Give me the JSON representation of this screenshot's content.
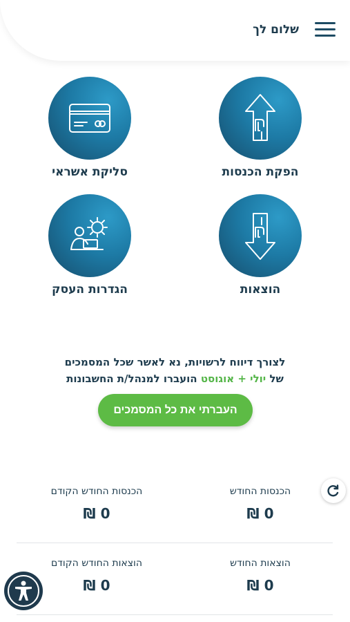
{
  "header": {
    "greeting": "שלום לך",
    "menu_icon": "hamburger-menu-icon"
  },
  "tiles": [
    {
      "label": "הפקת הכנסות",
      "icon": "income-arrow-up-shekel-icon"
    },
    {
      "label": "סליקת אשראי",
      "icon": "credit-card-icon"
    },
    {
      "label": "הוצאות",
      "icon": "expense-arrow-down-shekel-icon"
    },
    {
      "label": "הגדרות העסק",
      "icon": "business-settings-gear-icon"
    }
  ],
  "notice": {
    "line1": "לצורך דיווח לרשויות, נא לאשר שכל המסמכים",
    "line2_prefix": "של",
    "line2_months": "יולי + אוגוסט",
    "line2_suffix": "הועברו למנהל/ת החשבונות"
  },
  "cta": {
    "label": "העברתי את כל המסמכים"
  },
  "stats": {
    "income_month_label": "הכנסות החודש",
    "income_month_value": "0 ₪",
    "income_prev_label": "הכנסות החודש הקודם",
    "income_prev_value": "0 ₪",
    "expense_month_label": "הוצאות החודש",
    "expense_month_value": "0 ₪",
    "expense_prev_label": "הוצאות החודש הקודם",
    "expense_prev_value": "0 ₪"
  },
  "colors": {
    "brand_dark": "#1d3b4d",
    "circle_light": "#2d9ac7",
    "circle_dark": "#164d6c",
    "cta_green": "#5dbb45",
    "highlight_green": "#54b548"
  }
}
